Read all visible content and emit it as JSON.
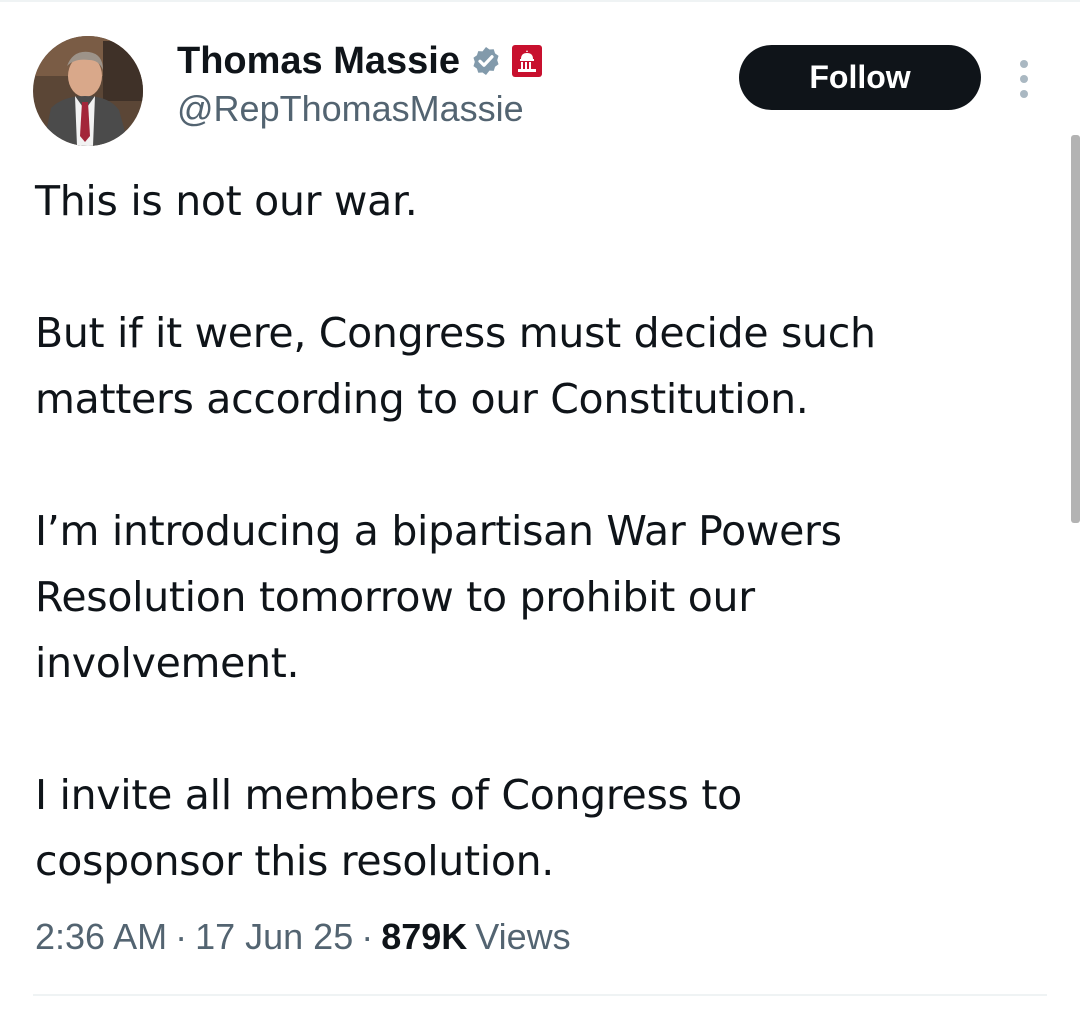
{
  "author": {
    "display_name": "Thomas Massie",
    "handle": "@RepThomasMassie",
    "verified_badge_color": "#829aab",
    "gov_badge_color": "#c8102e"
  },
  "actions": {
    "follow_label": "Follow"
  },
  "tweet": {
    "paragraphs": [
      "This is not our war.",
      "But if it were, Congress must decide such\nmatters according to our Constitution.",
      "I’m introducing a bipartisan War Powers\nResolution tomorrow to prohibit our\ninvolvement.",
      "I invite all members of Congress to\ncosponsor this resolution."
    ]
  },
  "meta": {
    "time": "2:36 AM",
    "separator": "·",
    "date": "17 Jun 25",
    "views_count": "879K",
    "views_label": "Views"
  },
  "icons": {
    "verified": "verified-badge-icon",
    "gov": "capitol-icon",
    "more": "more-vertical-icon"
  }
}
